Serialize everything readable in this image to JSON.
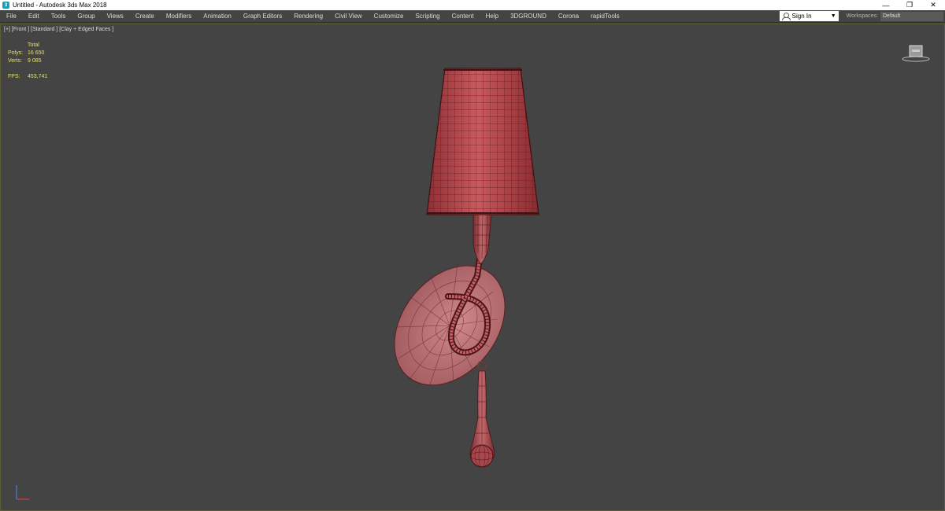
{
  "window": {
    "title": "Untitled - Autodesk 3ds Max 2018",
    "controls": {
      "minimize": "—",
      "restore": "❐",
      "close": "✕"
    }
  },
  "menu": {
    "items": [
      "File",
      "Edit",
      "Tools",
      "Group",
      "Views",
      "Create",
      "Modifiers",
      "Animation",
      "Graph Editors",
      "Rendering",
      "Civil View",
      "Customize",
      "Scripting",
      "Content",
      "Help",
      "3DGROUND",
      "Corona",
      "rapidTools"
    ],
    "sign_in": "Sign In",
    "workspaces_label": "Workspaces:",
    "workspace_value": "Default"
  },
  "viewport": {
    "label": "[+] [Front ] [Standard ] [Clay + Edged Faces ]",
    "stats": {
      "header": "Total",
      "polys_label": "Polys:",
      "polys_value": "16 650",
      "verts_label": "Verts:",
      "verts_value": "9 085",
      "fps_label": "FPS:",
      "fps_value": "453,741"
    }
  },
  "colors": {
    "viewport_bg": "#444444",
    "model_fill": "#b0454a",
    "model_wire": "#4a1518",
    "stats_text": "#e6e25e"
  }
}
